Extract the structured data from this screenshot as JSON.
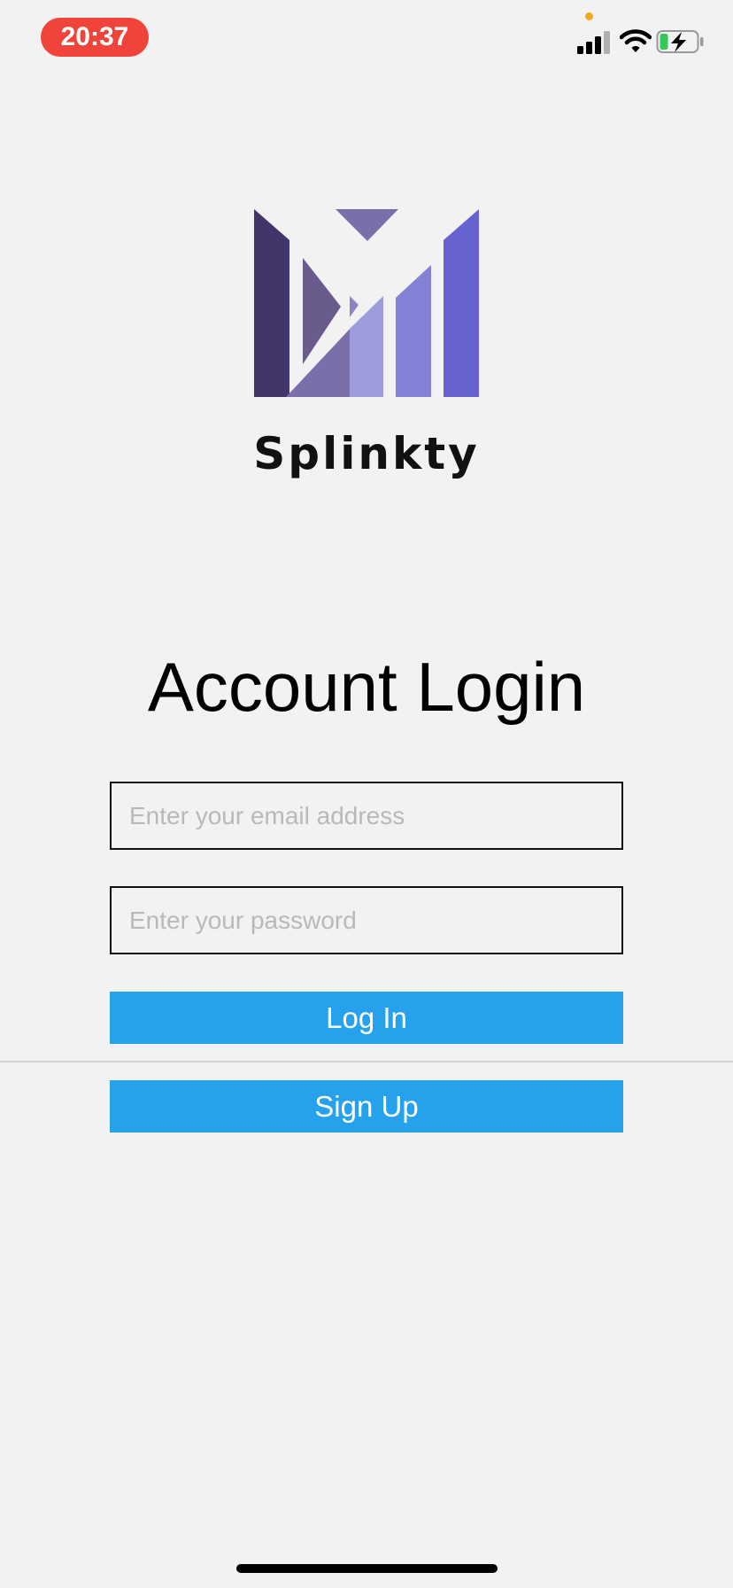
{
  "status_bar": {
    "time": "20:37",
    "accent_color": "#f0443a",
    "icons": [
      "cellular-signal-icon",
      "wifi-icon",
      "battery-charging-icon"
    ]
  },
  "brand": {
    "name": "Splinkty",
    "logo_colors": [
      "#41356a",
      "#6a5b8d",
      "#7a6fa9",
      "#9f9cdb",
      "#8381d6",
      "#6662cf"
    ]
  },
  "login": {
    "title": "Account Login",
    "email_placeholder": "Enter your email address",
    "password_placeholder": "Enter your password",
    "login_label": "Log In",
    "signup_label": "Sign Up",
    "button_color": "#26a1ec"
  }
}
